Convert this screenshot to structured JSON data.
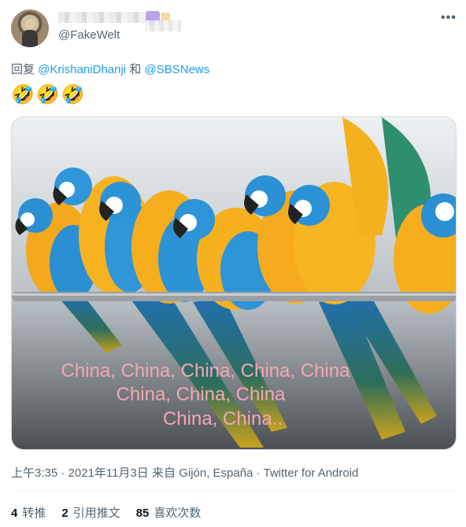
{
  "tweet": {
    "handle": "@FakeWelt",
    "reply_prefix": "回复",
    "reply_user1": "@KrishaniDhanji",
    "reply_joiner": "和",
    "reply_user2": "@SBSNews",
    "emoji_text": "🤣🤣🤣",
    "image": {
      "caption_line1": "China, China, China, China, China",
      "caption_line2": "China, China, China",
      "caption_line3": "China, China.."
    },
    "time": "上午3:35",
    "date": "2021年11月3日",
    "location_prefix": "来自",
    "location": "Gijón, España",
    "source": "Twitter for Android",
    "separator": "·",
    "more_icon_text": "•••"
  },
  "stats": {
    "retweets_count": "4",
    "retweets_label": "转推",
    "quotes_count": "2",
    "quotes_label": "引用推文",
    "likes_count": "85",
    "likes_label": "喜欢次数"
  },
  "colors": {
    "link": "#1d9bf0",
    "secondary_text": "#536471",
    "caption_text": "#f4a6b4"
  }
}
